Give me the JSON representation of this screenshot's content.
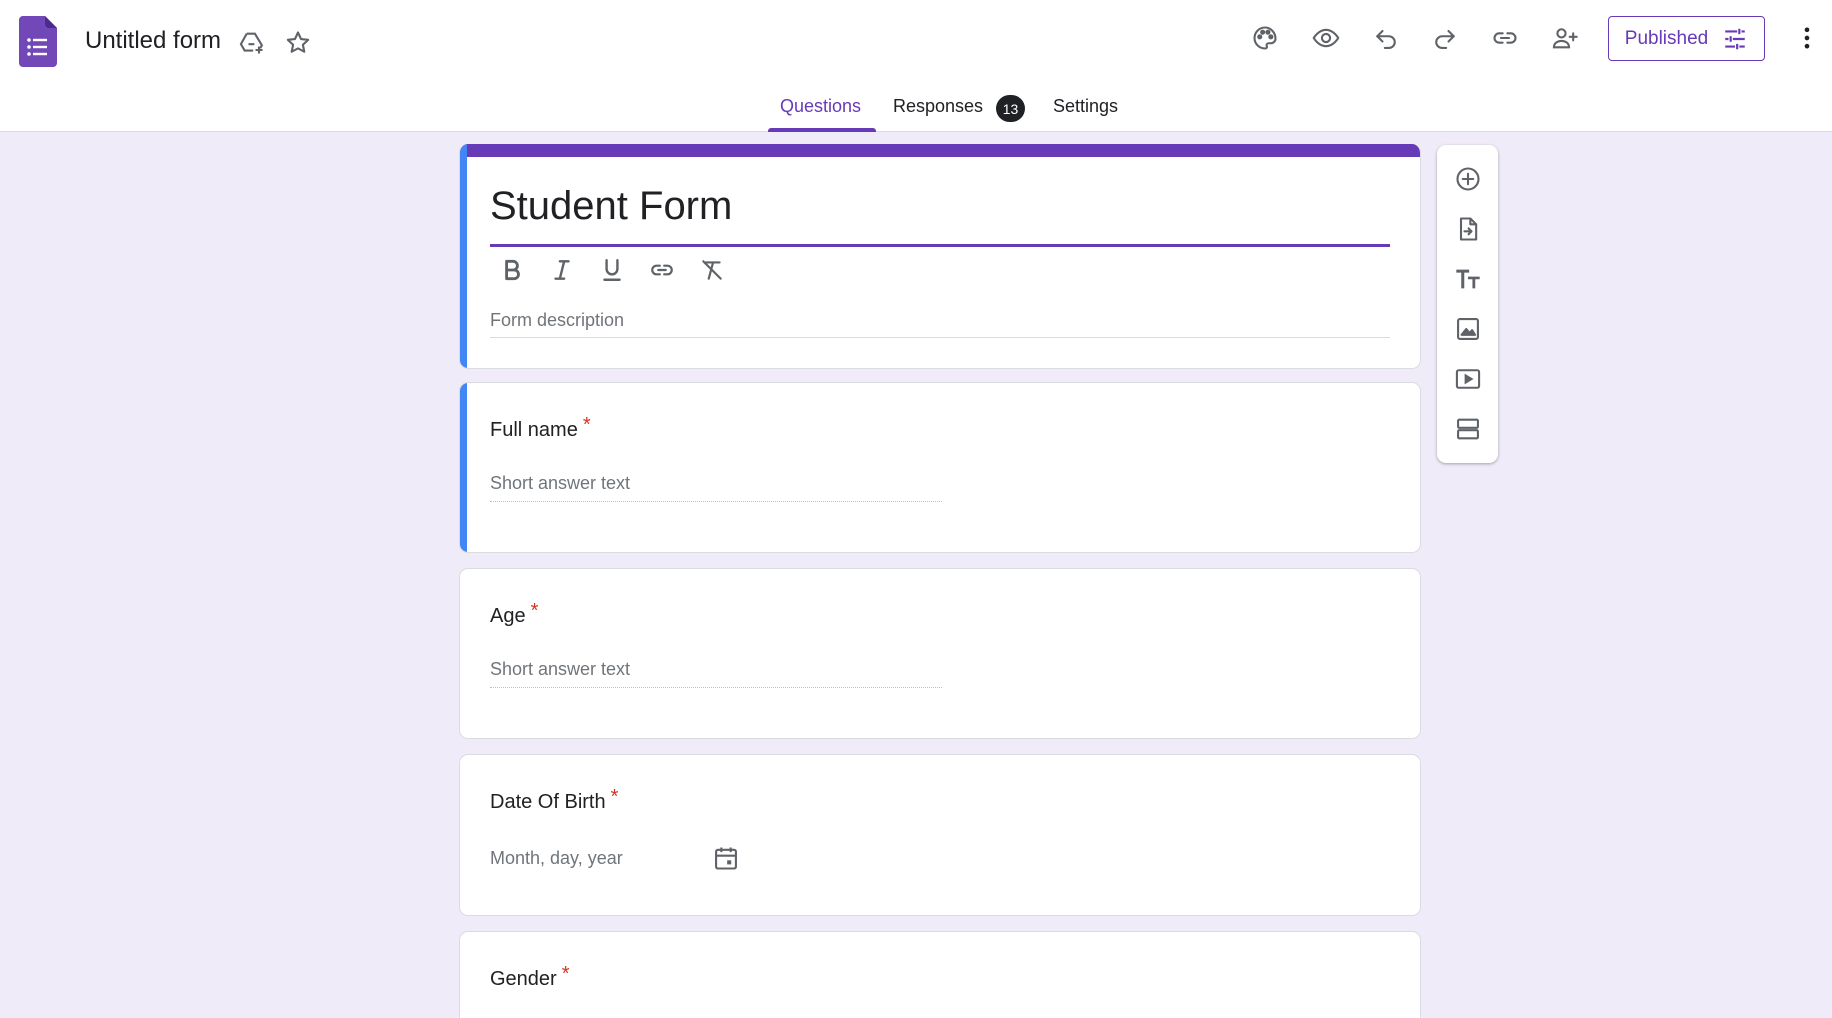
{
  "app": {
    "doc_title": "Untitled form",
    "logo_icon": "google-forms-logo",
    "title_icons": [
      "drive-add-icon",
      "star-icon"
    ]
  },
  "toolbar": {
    "icons": [
      "palette-icon",
      "eye-icon",
      "undo-icon",
      "redo-icon",
      "link-icon",
      "add-collaborator-icon"
    ],
    "published_label": "Published",
    "published_icon": "tune-icon",
    "more_icon": "more-vert-icon"
  },
  "tabs": [
    {
      "label": "Questions",
      "active": true
    },
    {
      "label": "Responses",
      "badge": "13"
    },
    {
      "label": "Settings"
    }
  ],
  "form": {
    "title": "Student Form",
    "format_tools": [
      "bold-icon",
      "italic-icon",
      "underline-icon",
      "link-icon",
      "clear-format-icon"
    ],
    "description_placeholder": "Form description"
  },
  "questions": [
    {
      "title": "Full name",
      "required": "*",
      "answer_placeholder": "Short answer text"
    },
    {
      "title": "Age",
      "required": "*",
      "answer_placeholder": "Short answer text"
    },
    {
      "title": "Date Of Birth",
      "required": "*",
      "answer_placeholder": "Month, day, year",
      "icon": "calendar-icon"
    },
    {
      "title": "Gender",
      "required": "*"
    }
  ],
  "side_toolbar": [
    "add-question-icon",
    "import-questions-icon",
    "add-title-icon",
    "add-image-icon",
    "add-video-icon",
    "add-section-icon"
  ],
  "colors": {
    "accent": "#673ab7",
    "focus_bar": "#4285f4",
    "page_bg": "#f0ebf8",
    "required": "#d93025"
  }
}
